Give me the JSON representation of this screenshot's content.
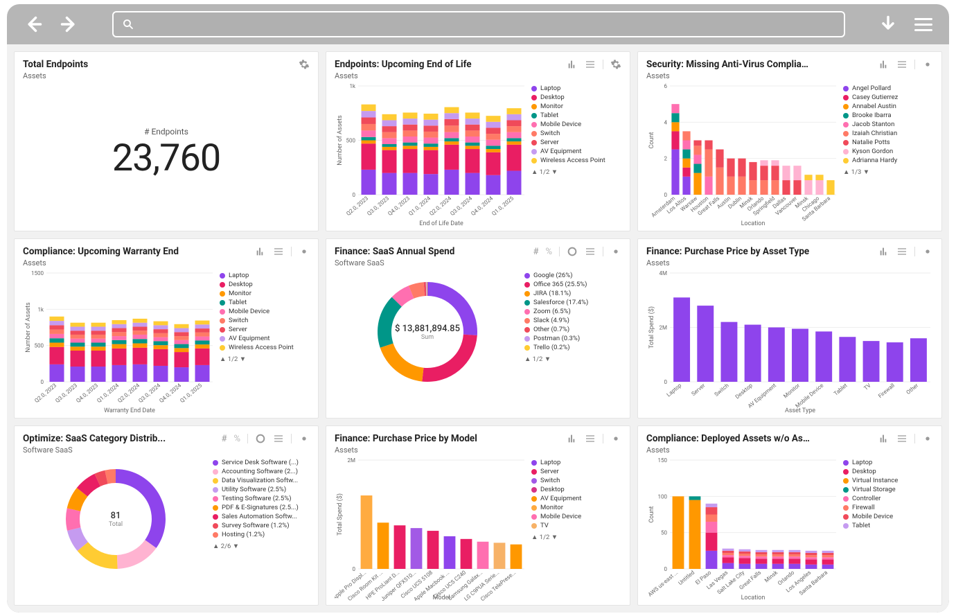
{
  "chrome": {
    "search_placeholder": ""
  },
  "cards": {
    "total_endpoints": {
      "title": "Total Endpoints",
      "subtitle": "Assets",
      "kpi_label": "# Endpoints",
      "kpi_value": "23,760"
    },
    "eol": {
      "title": "Endpoints: Upcoming End of Life",
      "subtitle": "Assets",
      "ylabel": "Number of Assets",
      "xlabel": "End of Life Date",
      "pager": "1/2"
    },
    "av_compliance": {
      "title": "Security: Missing Anti-Virus Compliance by Loc...",
      "subtitle": "Assets",
      "ylabel": "Count",
      "xlabel": "Location",
      "pager": "1/3"
    },
    "warranty": {
      "title": "Compliance: Upcoming Warranty End",
      "subtitle": "Assets",
      "ylabel": "Number of Assets",
      "xlabel": "Warranty End Date",
      "pager": "1/2"
    },
    "saas_spend": {
      "title": "Finance: SaaS Annual Spend",
      "subtitle": "Software SaaS",
      "center_value": "$ 13,881,894.85",
      "center_sub": "Sum",
      "pager": "1/2"
    },
    "price_by_type": {
      "title": "Finance: Purchase Price by Asset Type",
      "subtitle": "Assets",
      "ylabel": "Total Spend ($)",
      "xlabel": "Asset Type"
    },
    "saas_category": {
      "title": "Optimize: SaaS Category Distrib...",
      "subtitle": "Software SaaS",
      "center_value": "81",
      "center_sub": "Total",
      "pager": "2/6"
    },
    "price_by_model": {
      "title": "Finance: Purchase Price by Model",
      "subtitle": "Assets",
      "ylabel": "Total Spend ($)",
      "xlabel": "Model",
      "pager": "1/2"
    },
    "no_assignee": {
      "title": "Compliance: Deployed Assets w/o Assignee",
      "subtitle": "Assets",
      "ylabel": "Count",
      "xlabel": "Location"
    }
  },
  "colors": {
    "purple": "#8e44ec",
    "magenta": "#e91e63",
    "orange": "#ff9800",
    "teal": "#009688",
    "pink": "#ff6fb0",
    "salmon": "#ff7a66",
    "yellow": "#ffcc33",
    "red": "#f04a5a",
    "lightpurple": "#c59bf0",
    "lightpink": "#ffb3d1"
  },
  "chart_data": [
    {
      "id": "eol",
      "type": "bar",
      "stacked": true,
      "xlabel": "End of Life Date",
      "ylabel": "Number of Assets",
      "ylim": [
        0,
        1000
      ],
      "categories": [
        "Q2.0, 2023",
        "Q3.0, 2023",
        "Q4.0, 2023",
        "Q1.0, 2024",
        "Q2.0, 2024",
        "Q3.0, 2024",
        "Q4.0, 2024",
        "Q1.0, 2025"
      ],
      "series": [
        {
          "name": "Laptop",
          "color": "#8e44ec",
          "values": [
            230,
            200,
            200,
            190,
            230,
            200,
            180,
            220
          ]
        },
        {
          "name": "Desktop",
          "color": "#e91e63",
          "values": [
            240,
            210,
            220,
            220,
            230,
            220,
            210,
            240
          ]
        },
        {
          "name": "Monitor",
          "color": "#ff9800",
          "values": [
            30,
            30,
            30,
            30,
            30,
            30,
            30,
            30
          ]
        },
        {
          "name": "Tablet",
          "color": "#009688",
          "values": [
            30,
            25,
            30,
            30,
            30,
            30,
            30,
            30
          ]
        },
        {
          "name": "Mobile Device",
          "color": "#ff6fb0",
          "values": [
            60,
            55,
            55,
            55,
            55,
            55,
            55,
            55
          ]
        },
        {
          "name": "Switch",
          "color": "#ff7a66",
          "values": [
            60,
            55,
            55,
            55,
            60,
            55,
            55,
            55
          ]
        },
        {
          "name": "Server",
          "color": "#f04a5a",
          "values": [
            60,
            55,
            55,
            55,
            60,
            55,
            55,
            55
          ]
        },
        {
          "name": "AV Equipment",
          "color": "#c59bf0",
          "values": [
            60,
            55,
            55,
            55,
            55,
            55,
            55,
            55
          ]
        },
        {
          "name": "Wireless Access Point",
          "color": "#ffcc33",
          "values": [
            60,
            55,
            55,
            55,
            55,
            55,
            55,
            55
          ]
        }
      ]
    },
    {
      "id": "av_compliance",
      "type": "bar",
      "stacked": true,
      "xlabel": "Location",
      "ylabel": "Count",
      "ylim": [
        0,
        6
      ],
      "categories": [
        "Amsterdam",
        "Los Altos",
        "Warsaw",
        "Houston",
        "Great Falls",
        "Austin",
        "Dublin",
        "Minsk",
        "Orlando",
        "Springfield",
        "Dallas",
        "Vancouver",
        "Minsk",
        "Chicago",
        "Santa Barbara"
      ],
      "series": [
        {
          "name": "Angel Pollard",
          "color": "#8e44ec",
          "values": [
            2.5,
            1.0,
            0,
            0,
            0,
            0,
            0,
            0,
            0,
            0,
            0,
            0,
            0,
            0,
            0
          ]
        },
        {
          "name": "Casey Gutierrez",
          "color": "#e91e63",
          "values": [
            1.0,
            0.5,
            0,
            0,
            0,
            0,
            0,
            0,
            0,
            0,
            0,
            0,
            0,
            0,
            0
          ]
        },
        {
          "name": "Annabel Austin",
          "color": "#ff9800",
          "values": [
            0.5,
            0.5,
            1.2,
            0,
            0,
            0,
            0,
            0,
            0,
            0,
            0,
            0,
            0,
            0,
            0
          ]
        },
        {
          "name": "Brooke Ibarra",
          "color": "#009688",
          "values": [
            0.5,
            0.5,
            0.5,
            0,
            0,
            0,
            0,
            0,
            0,
            0,
            0,
            0,
            0,
            0,
            0
          ]
        },
        {
          "name": "Jacob Stanton",
          "color": "#ff6fb0",
          "values": [
            0.5,
            0.5,
            0.5,
            1.0,
            0,
            0,
            0,
            0,
            0,
            0,
            0,
            0,
            0,
            0,
            0
          ]
        },
        {
          "name": "Izaiah Christian",
          "color": "#ff7a66",
          "values": [
            0,
            0.5,
            0.5,
            1.5,
            1.5,
            1.0,
            1.0,
            0.8,
            0.8,
            0.8,
            0,
            0,
            0,
            0,
            0
          ]
        },
        {
          "name": "Natalie Potts",
          "color": "#f04a5a",
          "values": [
            0,
            0,
            0.3,
            0.5,
            1.0,
            1.0,
            1.0,
            1.0,
            0.8,
            0.8,
            0.8,
            0.8,
            0,
            0,
            0
          ]
        },
        {
          "name": "Kyson Gordon",
          "color": "#ffb3d1",
          "values": [
            0,
            0,
            0,
            0,
            0,
            0,
            0,
            0,
            0.3,
            0.3,
            0.8,
            0.8,
            0.8,
            0.8,
            0
          ]
        },
        {
          "name": "Adrianna Hardy",
          "color": "#ffcc33",
          "values": [
            0,
            0,
            0,
            0,
            0,
            0,
            0,
            0,
            0,
            0,
            0,
            0,
            0.3,
            0.3,
            0.8
          ]
        }
      ]
    },
    {
      "id": "warranty",
      "type": "bar",
      "stacked": true,
      "xlabel": "Warranty End Date",
      "ylabel": "Number of Assets",
      "ylim": [
        0,
        1500
      ],
      "categories": [
        "Q2.0, 2023",
        "Q3.0, 2023",
        "Q4.0, 2023",
        "Q1.0, 2024",
        "Q2.0, 2024",
        "Q3.0, 2024",
        "Q4.0, 2024",
        "Q1.0, 2025"
      ],
      "series": [
        {
          "name": "Laptop",
          "color": "#8e44ec",
          "values": [
            240,
            210,
            210,
            230,
            240,
            220,
            200,
            230
          ]
        },
        {
          "name": "Desktop",
          "color": "#e91e63",
          "values": [
            240,
            220,
            220,
            230,
            230,
            230,
            210,
            230
          ]
        },
        {
          "name": "Monitor",
          "color": "#ff9800",
          "values": [
            60,
            55,
            55,
            60,
            60,
            55,
            55,
            55
          ]
        },
        {
          "name": "Tablet",
          "color": "#009688",
          "values": [
            60,
            55,
            55,
            55,
            60,
            55,
            55,
            55
          ]
        },
        {
          "name": "Mobile Device",
          "color": "#ff6fb0",
          "values": [
            60,
            55,
            55,
            55,
            60,
            55,
            55,
            55
          ]
        },
        {
          "name": "Switch",
          "color": "#ff7a66",
          "values": [
            60,
            55,
            55,
            55,
            55,
            55,
            55,
            55
          ]
        },
        {
          "name": "Server",
          "color": "#f04a5a",
          "values": [
            60,
            55,
            55,
            55,
            55,
            55,
            55,
            55
          ]
        },
        {
          "name": "AV Equipment",
          "color": "#c59bf0",
          "values": [
            60,
            55,
            55,
            55,
            55,
            55,
            55,
            55
          ]
        },
        {
          "name": "Wireless Access Point",
          "color": "#ffcc33",
          "values": [
            60,
            55,
            55,
            55,
            55,
            55,
            55,
            55
          ]
        }
      ]
    },
    {
      "id": "saas_spend",
      "type": "pie",
      "title": "Finance: SaaS Annual Spend",
      "center_value": "$ 13,881,894.85",
      "center_sub": "Sum",
      "series": [
        {
          "name": "Google (26%)",
          "color": "#8e44ec",
          "value": 26.0
        },
        {
          "name": "Office 365 (25.5%)",
          "color": "#e91e63",
          "value": 25.5
        },
        {
          "name": "JIRA (18.1%)",
          "color": "#ff9800",
          "value": 18.1
        },
        {
          "name": "Salesforce (17.4%)",
          "color": "#009688",
          "value": 17.4
        },
        {
          "name": "Zoom (6.5%)",
          "color": "#ff6fb0",
          "value": 6.5
        },
        {
          "name": "Slack (4.9%)",
          "color": "#ff7a66",
          "value": 4.9
        },
        {
          "name": "Other (0.7%)",
          "color": "#f04a5a",
          "value": 0.7
        },
        {
          "name": "Postman (0.3%)",
          "color": "#c59bf0",
          "value": 0.3
        },
        {
          "name": "Trello (0.2%)",
          "color": "#ffcc33",
          "value": 0.2
        }
      ]
    },
    {
      "id": "price_by_type",
      "type": "bar",
      "xlabel": "Asset Type",
      "ylabel": "Total Spend ($)",
      "ylim": [
        0,
        4000000
      ],
      "categories": [
        "Laptop",
        "Server",
        "Switch",
        "Desktop",
        "AV Equipment",
        "Monitor",
        "Mobile Device",
        "Tablet",
        "TV",
        "Firewall",
        "Other"
      ],
      "series": [
        {
          "name": "Spend",
          "color": "#8e44ec",
          "values": [
            3100000,
            2800000,
            2200000,
            2100000,
            2000000,
            1950000,
            1850000,
            1650000,
            1500000,
            1450000,
            1600000
          ]
        }
      ]
    },
    {
      "id": "saas_category",
      "type": "pie",
      "title": "Optimize: SaaS Category Distribution",
      "center_value": "81",
      "center_sub": "Total",
      "series": [
        {
          "name": "Service Desk Software (...)",
          "color": "#8e44ec",
          "value": 12
        },
        {
          "name": "Accounting Software (2...)",
          "color": "#ffb3d1",
          "value": 5
        },
        {
          "name": "Data Visualization Softw...",
          "color": "#ffcc33",
          "value": 5
        },
        {
          "name": "Utility Software (2.5%)",
          "color": "#c59bf0",
          "value": 2.5
        },
        {
          "name": "Testing Software (2.5%)",
          "color": "#ff6fb0",
          "value": 2.5
        },
        {
          "name": "PDF & E-Signatures (2.5...)",
          "color": "#ff9800",
          "value": 2.5
        },
        {
          "name": "Sales Automation Softw...",
          "color": "#e91e63",
          "value": 2.5
        },
        {
          "name": "Survey Software (1.2%)",
          "color": "#f04a5a",
          "value": 1.2
        },
        {
          "name": "Hosting (1.2%)",
          "color": "#ff7a66",
          "value": 1.2
        }
      ]
    },
    {
      "id": "price_by_model",
      "type": "bar",
      "xlabel": "Model",
      "ylabel": "Total Spend ($)",
      "ylim": [
        0,
        2000000
      ],
      "categories": [
        "Apple Pro Displ...",
        "Cisco Room Kit ...",
        "HPE ProLiant D...",
        "Juniper QFX510...",
        "Cisco UCS 5108",
        "Apple Macbook ...",
        "Cisco UCS C240",
        "Samsung Galax...",
        "LG C9PUA Serie...",
        "Cisco TelePrese..."
      ],
      "series": [
        {
          "name": "Laptop",
          "color": "#8e44ec",
          "values": [
            0,
            0,
            0,
            0,
            0,
            600000,
            0,
            0,
            0,
            0
          ]
        },
        {
          "name": "Server",
          "color": "#e91e63",
          "values": [
            0,
            0,
            800000,
            0,
            700000,
            0,
            550000,
            0,
            0,
            0
          ]
        },
        {
          "name": "Switch",
          "color": "#a259e6",
          "values": [
            0,
            0,
            0,
            750000,
            0,
            0,
            0,
            0,
            0,
            0
          ]
        },
        {
          "name": "Desktop",
          "color": "#d63384",
          "values": [
            0,
            0,
            0,
            0,
            0,
            0,
            0,
            0,
            0,
            0
          ]
        },
        {
          "name": "AV Equipment",
          "color": "#ff9800",
          "values": [
            0,
            850000,
            0,
            0,
            0,
            0,
            0,
            0,
            0,
            450000
          ]
        },
        {
          "name": "Monitor",
          "color": "#ffab40",
          "values": [
            1350000,
            0,
            0,
            0,
            0,
            0,
            0,
            0,
            0,
            0
          ]
        },
        {
          "name": "Mobile Device",
          "color": "#ff6fb0",
          "values": [
            0,
            0,
            0,
            0,
            0,
            0,
            0,
            500000,
            0,
            0
          ]
        },
        {
          "name": "TV",
          "color": "#f7b267",
          "values": [
            0,
            0,
            0,
            0,
            0,
            0,
            0,
            0,
            480000,
            0
          ]
        }
      ]
    },
    {
      "id": "no_assignee",
      "type": "bar",
      "stacked": true,
      "xlabel": "Location",
      "ylabel": "Count",
      "ylim": [
        0,
        150
      ],
      "categories": [
        "AWS us-east ...",
        "Untitled",
        "El Paso",
        "Las Vegas",
        "Salt Lake City",
        "Great Falls",
        "Minsk",
        "Orlando",
        "Los Angeles",
        "Santa Barbara"
      ],
      "series": [
        {
          "name": "Laptop",
          "color": "#8e44ec",
          "values": [
            0,
            0,
            25,
            8,
            7,
            7,
            7,
            7,
            6,
            6
          ]
        },
        {
          "name": "Desktop",
          "color": "#e91e63",
          "values": [
            0,
            0,
            25,
            8,
            8,
            7,
            7,
            7,
            7,
            7
          ]
        },
        {
          "name": "Virtual Instance",
          "color": "#ff9800",
          "values": [
            100,
            95,
            0,
            0,
            0,
            0,
            0,
            0,
            0,
            0
          ]
        },
        {
          "name": "Virtual Storage",
          "color": "#009688",
          "values": [
            0,
            5,
            0,
            0,
            0,
            0,
            0,
            0,
            0,
            0
          ]
        },
        {
          "name": "Controller",
          "color": "#ff6fb0",
          "values": [
            0,
            0,
            15,
            3,
            3,
            3,
            3,
            3,
            3,
            3
          ]
        },
        {
          "name": "Firewall",
          "color": "#ff7a66",
          "values": [
            0,
            0,
            10,
            3,
            3,
            3,
            3,
            3,
            3,
            3
          ]
        },
        {
          "name": "Mobile Device",
          "color": "#f04a5a",
          "values": [
            0,
            0,
            10,
            3,
            3,
            3,
            3,
            3,
            3,
            3
          ]
        },
        {
          "name": "Tablet",
          "color": "#c59bf0",
          "values": [
            0,
            0,
            5,
            3,
            3,
            3,
            3,
            3,
            3,
            3
          ]
        }
      ]
    }
  ]
}
